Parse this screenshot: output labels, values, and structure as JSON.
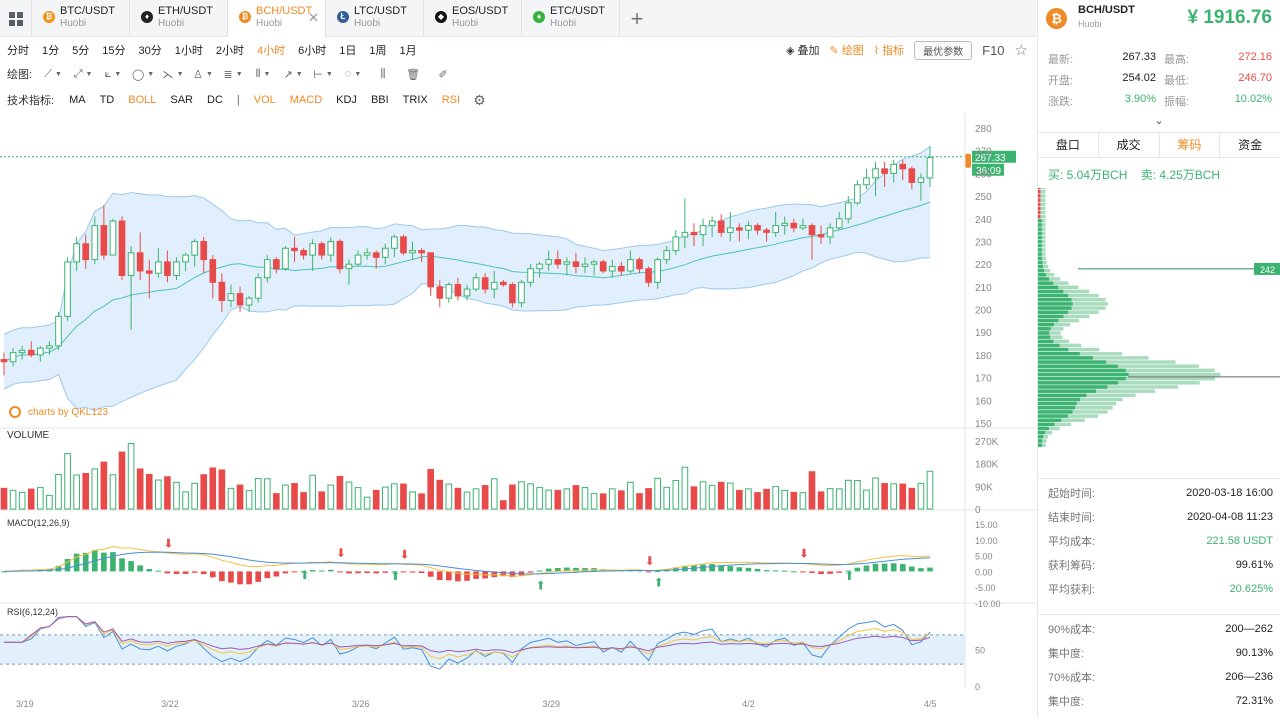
{
  "tabs": [
    {
      "pair": "BTC/USDT",
      "exchange": "Huobi",
      "color": "#f7931a",
      "glyph": "₿"
    },
    {
      "pair": "ETH/USDT",
      "exchange": "Huobi",
      "color": "#222222",
      "glyph": "♦"
    },
    {
      "pair": "BCH/USDT",
      "exchange": "Huobi",
      "color": "#f08a24",
      "glyph": "₿"
    },
    {
      "pair": "LTC/USDT",
      "exchange": "Huobi",
      "color": "#345d9d",
      "glyph": "Ł"
    },
    {
      "pair": "EOS/USDT",
      "exchange": "Huobi",
      "color": "#111111",
      "glyph": "◆"
    },
    {
      "pair": "ETC/USDT",
      "exchange": "Huobi",
      "color": "#3ab03e",
      "glyph": "♦"
    }
  ],
  "timeframes": [
    "分时",
    "1分",
    "5分",
    "15分",
    "30分",
    "1小时",
    "2小时",
    "4小时",
    "6小时",
    "1日",
    "1周",
    "1月"
  ],
  "active_timeframe": "4小时",
  "toolbar": {
    "overlay": "叠加",
    "draw": "绘图",
    "indicator": "指标",
    "best_params": "最优参数",
    "f10": "F10"
  },
  "draw_label": "绘图:",
  "indicator_label": "技术指标:",
  "indicators": [
    {
      "name": "MA",
      "active": false
    },
    {
      "name": "TD",
      "active": false
    },
    {
      "name": "BOLL",
      "active": true
    },
    {
      "name": "SAR",
      "active": false
    },
    {
      "name": "DC",
      "active": false
    },
    {
      "name": "|",
      "active": false
    },
    {
      "name": "VOL",
      "active": true
    },
    {
      "name": "MACD",
      "active": true
    },
    {
      "name": "KDJ",
      "active": false
    },
    {
      "name": "BBI",
      "active": false
    },
    {
      "name": "TRIX",
      "active": false
    },
    {
      "name": "RSI",
      "active": true
    }
  ],
  "colors": {
    "up": "#3cb371",
    "down": "#e84a4a",
    "accent": "#f08a24",
    "band": "#d6e9fa",
    "mid": "#4fc3ba"
  },
  "chart_data": {
    "type": "candlestick",
    "watermark": "charts by QKL123",
    "price_axis": {
      "ticks": [
        280,
        270,
        260,
        250,
        240,
        230,
        220,
        210,
        200,
        190,
        180,
        170,
        160,
        150
      ],
      "min": 150,
      "max": 280
    },
    "last_price_label": "267.33",
    "countdown_label": "36:09",
    "x_labels": [
      "3/19",
      "3/22",
      "3/26",
      "3/29",
      "4/2",
      "4/5"
    ],
    "candles": [
      [
        178,
        181,
        171,
        177
      ],
      [
        177,
        183,
        175,
        181
      ],
      [
        181,
        184,
        178,
        182
      ],
      [
        182,
        186,
        179,
        180
      ],
      [
        180,
        184,
        177,
        183
      ],
      [
        183,
        186,
        180,
        184
      ],
      [
        184,
        199,
        182,
        197
      ],
      [
        197,
        223,
        195,
        221
      ],
      [
        221,
        232,
        217,
        229
      ],
      [
        229,
        233,
        218,
        222
      ],
      [
        222,
        241,
        220,
        237
      ],
      [
        237,
        246,
        222,
        224
      ],
      [
        224,
        240,
        224,
        239
      ],
      [
        239,
        241,
        213,
        215
      ],
      [
        215,
        228,
        191,
        225
      ],
      [
        225,
        234,
        213,
        217
      ],
      [
        217,
        222,
        205,
        216
      ],
      [
        216,
        227,
        214,
        221
      ],
      [
        221,
        226,
        212,
        215
      ],
      [
        215,
        223,
        213,
        221
      ],
      [
        221,
        225,
        217,
        224
      ],
      [
        224,
        231,
        219,
        230
      ],
      [
        230,
        232,
        216,
        222
      ],
      [
        222,
        224,
        205,
        212
      ],
      [
        212,
        216,
        199,
        204
      ],
      [
        204,
        211,
        201,
        207
      ],
      [
        207,
        210,
        199,
        202
      ],
      [
        202,
        206,
        199,
        205
      ],
      [
        205,
        216,
        203,
        214
      ],
      [
        214,
        224,
        212,
        222
      ],
      [
        222,
        223,
        216,
        218
      ],
      [
        218,
        228,
        217,
        227
      ],
      [
        227,
        232,
        221,
        226
      ],
      [
        226,
        227,
        222,
        224
      ],
      [
        224,
        231,
        217,
        229
      ],
      [
        229,
        230,
        222,
        224
      ],
      [
        224,
        232,
        221,
        230
      ],
      [
        230,
        231,
        216,
        218
      ],
      [
        218,
        222,
        211,
        220
      ],
      [
        220,
        226,
        219,
        224
      ],
      [
        224,
        227,
        222,
        225
      ],
      [
        225,
        226,
        218,
        223
      ],
      [
        223,
        229,
        220,
        227
      ],
      [
        227,
        233,
        223,
        232
      ],
      [
        232,
        233,
        224,
        225
      ],
      [
        225,
        230,
        222,
        226
      ],
      [
        226,
        227,
        221,
        225
      ],
      [
        225,
        225,
        206,
        210
      ],
      [
        210,
        213,
        201,
        205
      ],
      [
        205,
        212,
        203,
        211
      ],
      [
        211,
        214,
        204,
        206
      ],
      [
        206,
        211,
        204,
        209
      ],
      [
        209,
        216,
        208,
        214
      ],
      [
        214,
        216,
        207,
        209
      ],
      [
        209,
        217,
        205,
        212
      ],
      [
        212,
        213,
        210,
        211
      ],
      [
        211,
        212,
        201,
        203
      ],
      [
        203,
        213,
        201,
        212
      ],
      [
        212,
        220,
        210,
        218
      ],
      [
        218,
        221,
        214,
        220
      ],
      [
        220,
        226,
        217,
        222
      ],
      [
        222,
        226,
        218,
        220
      ],
      [
        220,
        223,
        215,
        221
      ],
      [
        221,
        225,
        216,
        219
      ],
      [
        219,
        223,
        216,
        220
      ],
      [
        220,
        222,
        215,
        221
      ],
      [
        221,
        222,
        216,
        217
      ],
      [
        217,
        222,
        214,
        219
      ],
      [
        219,
        221,
        215,
        217
      ],
      [
        217,
        226,
        216,
        222
      ],
      [
        222,
        223,
        216,
        218
      ],
      [
        218,
        219,
        210,
        212
      ],
      [
        212,
        223,
        209,
        222
      ],
      [
        222,
        228,
        220,
        226
      ],
      [
        226,
        235,
        224,
        232
      ],
      [
        232,
        249,
        227,
        234
      ],
      [
        234,
        238,
        228,
        233
      ],
      [
        233,
        240,
        228,
        237
      ],
      [
        237,
        241,
        232,
        239
      ],
      [
        239,
        242,
        232,
        234
      ],
      [
        234,
        243,
        230,
        236
      ],
      [
        236,
        238,
        230,
        235
      ],
      [
        235,
        239,
        231,
        237
      ],
      [
        237,
        238,
        233,
        235
      ],
      [
        235,
        236,
        230,
        234
      ],
      [
        234,
        243,
        232,
        237
      ],
      [
        237,
        241,
        233,
        238
      ],
      [
        238,
        240,
        234,
        236
      ],
      [
        236,
        240,
        235,
        237
      ],
      [
        237,
        238,
        222,
        233
      ],
      [
        233,
        237,
        229,
        232
      ],
      [
        232,
        238,
        229,
        236
      ],
      [
        236,
        243,
        235,
        240
      ],
      [
        240,
        250,
        238,
        247
      ],
      [
        247,
        257,
        246,
        255
      ],
      [
        255,
        262,
        253,
        258
      ],
      [
        258,
        265,
        250,
        262
      ],
      [
        262,
        265,
        254,
        260
      ],
      [
        260,
        266,
        256,
        264
      ],
      [
        264,
        266,
        257,
        262
      ],
      [
        262,
        263,
        253,
        256
      ],
      [
        256,
        260,
        248,
        258
      ],
      [
        258,
        272,
        254,
        267
      ]
    ],
    "volume": {
      "label": "VOLUME",
      "ticks": [
        "270K",
        "180K",
        "90K",
        "0"
      ],
      "max": 270
    },
    "macd": {
      "label": "MACD(12,26,9)",
      "ticks": [
        "15.00",
        "10.00",
        "5.00",
        "0.00",
        "-5.00",
        "-10.00"
      ],
      "min": -10,
      "max": 15
    },
    "rsi": {
      "label": "RSI(6,12,24)",
      "ticks": [
        "50",
        "0"
      ],
      "min": 0,
      "max": 100
    }
  },
  "right": {
    "pair": "BCH/USDT",
    "exchange": "Huobi",
    "price": "¥ 1916.76",
    "stats": [
      {
        "k1": "最新:",
        "v1": "267.33",
        "c1": "",
        "k2": "最高:",
        "v2": "272.16",
        "c2": "r"
      },
      {
        "k1": "开盘:",
        "v1": "254.02",
        "c1": "",
        "k2": "最低:",
        "v2": "246.70",
        "c2": "r"
      },
      {
        "k1": "涨跌:",
        "v1": "3.90%",
        "c1": "g",
        "k2": "振幅:",
        "v2": "10.02%",
        "c2": "g"
      }
    ],
    "tabs": [
      "盘口",
      "成交",
      "筹码",
      "资金"
    ],
    "active_tab": "筹码",
    "buy": "买: 5.04万BCH",
    "sell": "卖: 4.25万BCH",
    "chip_label": "242",
    "info": [
      {
        "k": "起始时间:",
        "v": "2020-03-18 16:00",
        "c": ""
      },
      {
        "k": "结束时间:",
        "v": "2020-04-08 11:23",
        "c": ""
      },
      {
        "k": "平均成本:",
        "v": "221.58 USDT",
        "c": "g"
      },
      {
        "k": "获利筹码:",
        "v": "99.61%",
        "c": ""
      },
      {
        "k": "平均获利:",
        "v": "20.625%",
        "c": "g"
      }
    ],
    "info2": [
      {
        "k": "90%成本:",
        "v": "200—262"
      },
      {
        "k": "集中度:",
        "v": "90.13%"
      },
      {
        "k": "70%成本:",
        "v": "206—236"
      },
      {
        "k": "集中度:",
        "v": "72.31%"
      }
    ]
  }
}
